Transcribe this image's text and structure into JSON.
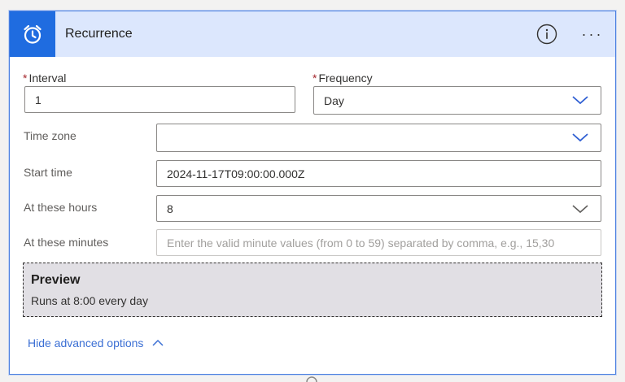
{
  "header": {
    "title": "Recurrence",
    "icon": "alarm-clock-icon",
    "info_icon": "info-icon",
    "more_icon": "more-icon",
    "more_label": "···",
    "accent": "#1f6ce0",
    "background": "#dce7fd"
  },
  "interval": {
    "required_mark": "*",
    "label": "Interval",
    "value": "1"
  },
  "frequency": {
    "required_mark": "*",
    "label": "Frequency",
    "value": "Day"
  },
  "time_zone": {
    "label": "Time zone",
    "value": ""
  },
  "start_time": {
    "label": "Start time",
    "value": "2024-11-17T09:00:00.000Z"
  },
  "hours": {
    "label": "At these hours",
    "value": "8"
  },
  "minutes": {
    "label": "At these minutes",
    "placeholder": "Enter the valid minute values (from 0 to 59) separated by comma, e.g., 15,30"
  },
  "preview": {
    "title": "Preview",
    "text": "Runs at 8:00 every day"
  },
  "advanced": {
    "label": "Hide advanced options"
  }
}
